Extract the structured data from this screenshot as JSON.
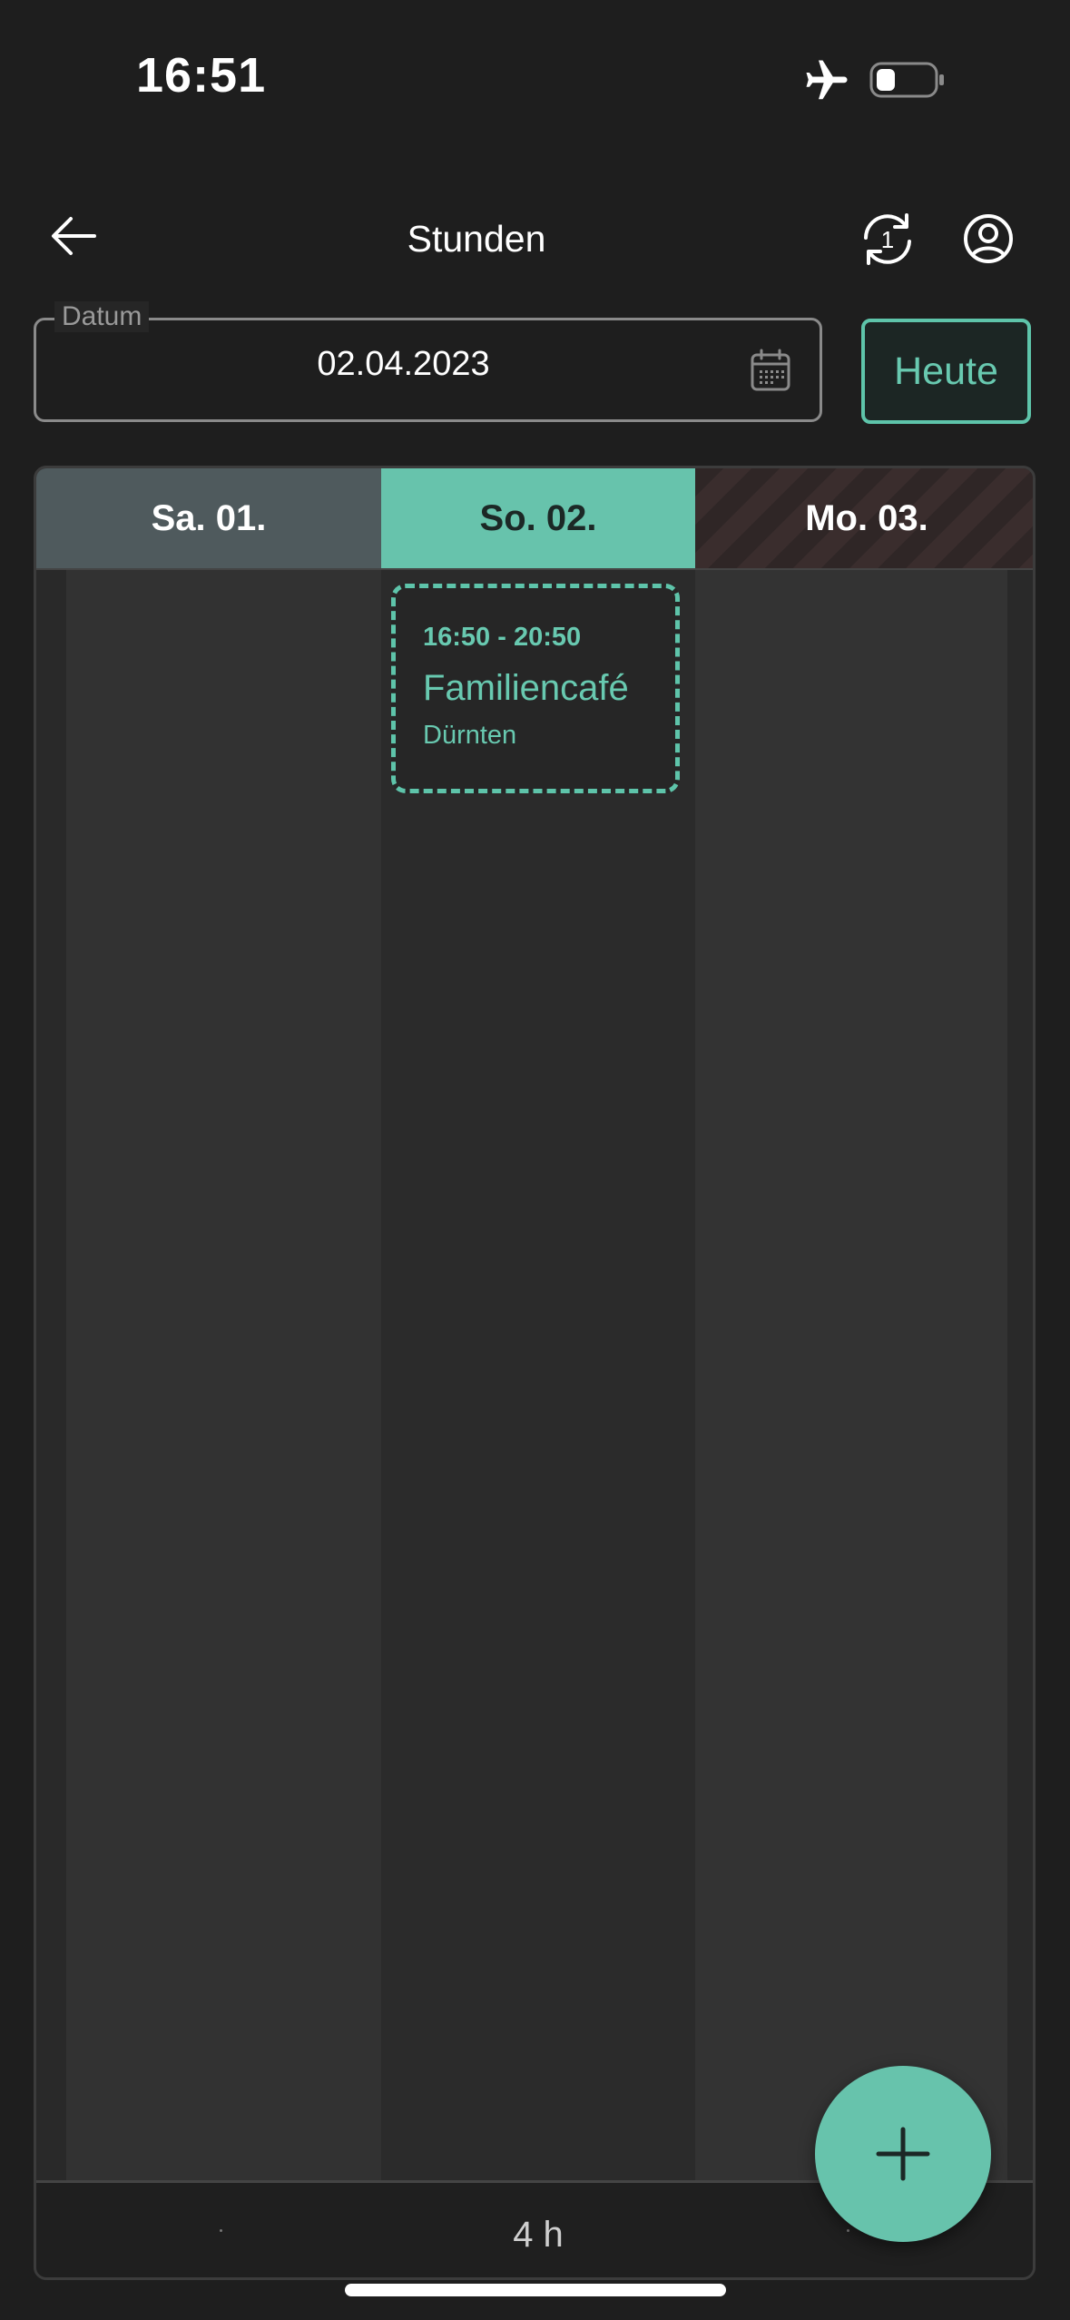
{
  "status_bar": {
    "time": "16:51",
    "icons": [
      "airplane-icon",
      "battery-icon"
    ]
  },
  "header": {
    "title": "Stunden",
    "icons": [
      "back-arrow-icon",
      "sync-icon",
      "profile-icon"
    ],
    "sync_badge": "1"
  },
  "date_picker": {
    "label": "Datum",
    "value": "02.04.2023",
    "icon": "calendar-icon",
    "today_label": "Heute"
  },
  "days": [
    {
      "label": "Sa. 01.",
      "state": "past",
      "total": ""
    },
    {
      "label": "So. 02.",
      "state": "selected",
      "total": "4 h"
    },
    {
      "label": "Mo. 03.",
      "state": "future",
      "total": ""
    }
  ],
  "entries": [
    {
      "time": "16:50 - 20:50",
      "title": "Familiencafé",
      "location": "Dürnten"
    }
  ],
  "fab": {
    "icon": "plus-icon"
  },
  "colors": {
    "accent": "#67c3ac",
    "background": "#1e1e1e",
    "past_day": "#4f5a5d"
  }
}
